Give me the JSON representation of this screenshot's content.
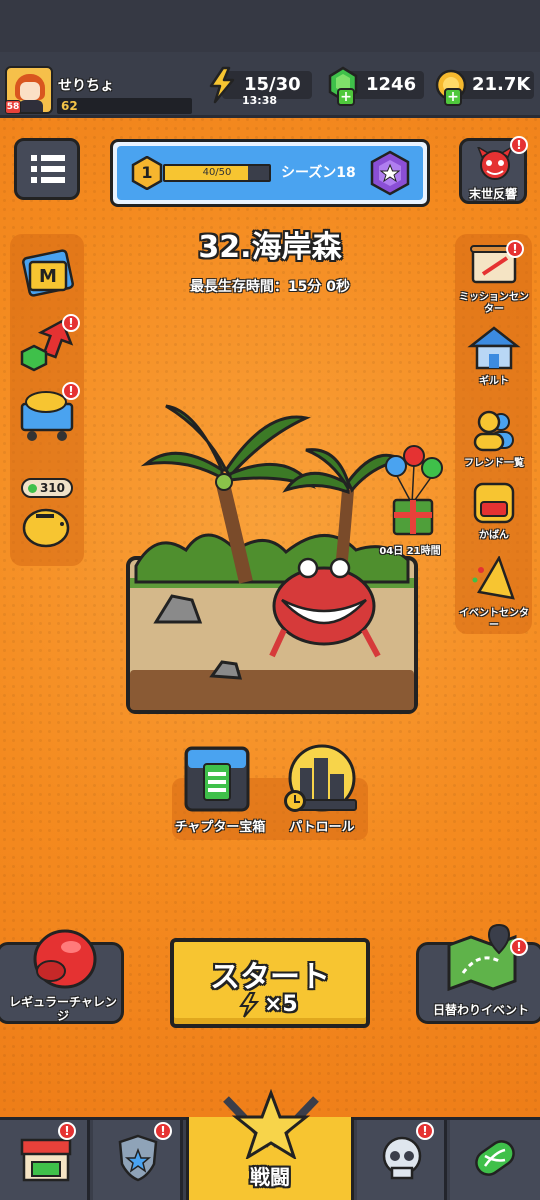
{
  "player": {
    "name": "せりちょ",
    "level": "62",
    "avatar_level": "58"
  },
  "resources": {
    "energy": "15/30",
    "energy_timer": "13:38",
    "gems": "1246",
    "coins": "21.7K"
  },
  "season": {
    "level": "1",
    "progress_text": "40/50",
    "progress": 0.8,
    "label": "シーズン18"
  },
  "top_right": {
    "label": "末世反響"
  },
  "stage": {
    "title": "32.海岸森",
    "best_time": "最長生存時間：15分 0秒"
  },
  "left_side": {
    "shop_count": "310"
  },
  "right_side": {
    "items": [
      {
        "label": "ミッションセンター",
        "icon": "scroll-icon"
      },
      {
        "label": "ギルト",
        "icon": "guild-house-icon"
      },
      {
        "label": "フレンド一覧",
        "icon": "friends-icon"
      },
      {
        "label": "かばん",
        "icon": "backpack-icon"
      },
      {
        "label": "イベントセンター",
        "icon": "party-hat-icon"
      }
    ]
  },
  "gift": {
    "timer": "04日 21時間"
  },
  "bottom_buttons": {
    "chapter_chest": "チャプター宝箱",
    "patrol": "パトロール"
  },
  "actions": {
    "regular_challenge": "レギュラーチャレンジ",
    "start": "スタート",
    "start_cost": "×5",
    "daily_event": "日替わりイベント"
  },
  "nav": {
    "battle": "戦闘"
  }
}
